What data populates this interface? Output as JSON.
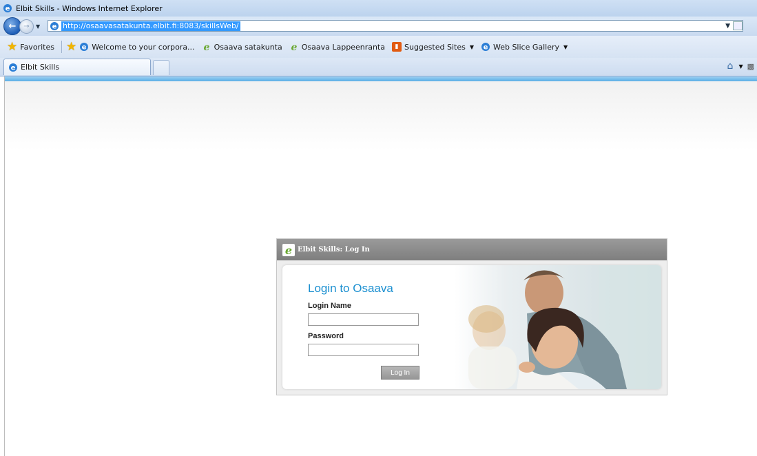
{
  "window": {
    "title": "Elbit Skills - Windows Internet Explorer"
  },
  "address_bar": {
    "url": "http://osaavasatakunta.elbit.fi:8083/skillsWeb/"
  },
  "favorites_bar": {
    "favorites_label": "Favorites",
    "items": [
      {
        "label": "Welcome to your corpora...",
        "icon": "ie-icon"
      },
      {
        "label": "Osaava satakunta",
        "icon": "osaava-icon"
      },
      {
        "label": "Osaava Lappeenranta",
        "icon": "osaava-icon"
      },
      {
        "label": "Suggested Sites",
        "icon": "suggested-sites-icon"
      },
      {
        "label": "Web Slice Gallery",
        "icon": "ie-icon"
      }
    ]
  },
  "tabs": [
    {
      "label": "Elbit Skills",
      "active": true
    }
  ],
  "login_panel": {
    "header_title": "Elbit Skills: Log In",
    "heading": "Login to Osaava",
    "login_name_label": "Login Name",
    "login_name_value": "",
    "password_label": "Password",
    "password_value": "",
    "submit_label": "Log In"
  },
  "colors": {
    "accent_blue": "#1a8fd0",
    "panel_header": "#8c8c8c",
    "page_strip": "#5aafe6"
  }
}
